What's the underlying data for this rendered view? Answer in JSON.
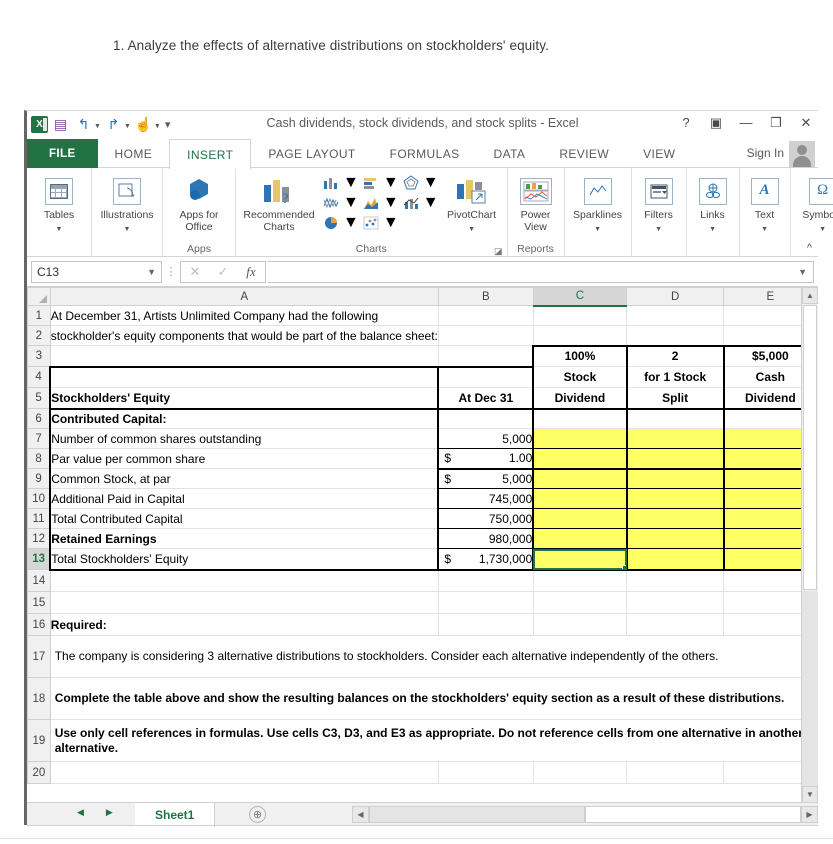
{
  "question": {
    "number": "1.",
    "text": "Analyze the effects of alternative distributions on stockholders' equity."
  },
  "window": {
    "title": "Cash dividends, stock dividends, and stock splits - Excel",
    "sign_in": "Sign In",
    "buttons": {
      "help": "?",
      "ribbon_display": "▣",
      "minimize": "—",
      "restore": "❐",
      "close": "✕"
    },
    "qat": {
      "save": "save-icon",
      "undo": "undo-icon",
      "redo": "redo-icon",
      "touch": "touch-mode-icon",
      "more": "customize-icon"
    }
  },
  "ribbon": {
    "tabs": [
      {
        "label": "FILE",
        "active": false
      },
      {
        "label": "HOME",
        "active": false
      },
      {
        "label": "INSERT",
        "active": true
      },
      {
        "label": "PAGE LAYOUT",
        "active": false
      },
      {
        "label": "FORMULAS",
        "active": false
      },
      {
        "label": "DATA",
        "active": false
      },
      {
        "label": "REVIEW",
        "active": false
      },
      {
        "label": "VIEW",
        "active": false
      }
    ],
    "groups": [
      {
        "label": "",
        "items": [
          {
            "label": "Tables",
            "dropdown": true
          }
        ]
      },
      {
        "label": "",
        "items": [
          {
            "label": "Illustrations",
            "dropdown": true
          }
        ]
      },
      {
        "label": "Apps",
        "items": [
          {
            "label": "Apps for Office",
            "dropdown": true
          }
        ]
      },
      {
        "label": "Charts",
        "items": [
          {
            "label": "Recommended Charts",
            "dropdown": false
          },
          {
            "label": "PivotChart",
            "dropdown": true
          }
        ]
      },
      {
        "label": "Reports",
        "items": [
          {
            "label": "Power View",
            "dropdown": false
          }
        ]
      },
      {
        "label": "",
        "items": [
          {
            "label": "Sparklines",
            "dropdown": true
          }
        ]
      },
      {
        "label": "",
        "items": [
          {
            "label": "Filters",
            "dropdown": true
          }
        ]
      },
      {
        "label": "",
        "items": [
          {
            "label": "Links",
            "dropdown": true
          }
        ]
      },
      {
        "label": "",
        "items": [
          {
            "label": "Text",
            "dropdown": true
          }
        ]
      },
      {
        "label": "",
        "items": [
          {
            "label": "Symbols",
            "dropdown": true
          }
        ]
      }
    ],
    "collapse": "^"
  },
  "formula_bar": {
    "name_box": "C13",
    "formula": "",
    "cancel": "✕",
    "enter": "✓",
    "fx": "fx"
  },
  "sheet": {
    "columns": [
      "A",
      "B",
      "C",
      "D",
      "E"
    ],
    "selected_column": "C",
    "selected_cell": "C13",
    "rows": [
      {
        "n": "1",
        "A": "At December 31,  Artists Unlimited Company had the following",
        "B": "",
        "C": "",
        "D": "",
        "E": ""
      },
      {
        "n": "2",
        "A": "stockholder's equity components that would be part of the balance sheet:",
        "B": "",
        "C": "",
        "D": "",
        "E": ""
      },
      {
        "n": "3",
        "A": "",
        "B": "",
        "C": "100%",
        "D": "2",
        "E": "$5,000"
      },
      {
        "n": "4",
        "A": "",
        "B": "",
        "C": "Stock",
        "D": "for 1 Stock",
        "E": "Cash"
      },
      {
        "n": "5",
        "A": "Stockholders' Equity",
        "B": "At Dec 31",
        "C": "Dividend",
        "D": "Split",
        "E": "Dividend"
      },
      {
        "n": "6",
        "A": "Contributed Capital:",
        "B": "",
        "C": "",
        "D": "",
        "E": ""
      },
      {
        "n": "7",
        "A": "Number of common shares outstanding",
        "B": "5,000",
        "C": "",
        "D": "",
        "E": ""
      },
      {
        "n": "8",
        "A": "Par value per common share",
        "B": "1.00",
        "B_dollar": "$",
        "C": "",
        "D": "",
        "E": ""
      },
      {
        "n": "9",
        "A": "   Common Stock, at par",
        "B": "5,000",
        "B_dollar": "$",
        "C": "",
        "D": "",
        "E": ""
      },
      {
        "n": "10",
        "A": "   Additional Paid in Capital",
        "B": "745,000",
        "C": "",
        "D": "",
        "E": ""
      },
      {
        "n": "11",
        "A": "      Total Contributed Capital",
        "B": "750,000",
        "C": "",
        "D": "",
        "E": ""
      },
      {
        "n": "12",
        "A": "Retained Earnings",
        "B": "980,000",
        "C": "",
        "D": "",
        "E": ""
      },
      {
        "n": "13",
        "A": "      Total Stockholders' Equity",
        "B": "1,730,000",
        "B_dollar": "$",
        "C": "",
        "D": "",
        "E": ""
      },
      {
        "n": "14",
        "A": "",
        "B": "",
        "C": "",
        "D": "",
        "E": ""
      },
      {
        "n": "15",
        "A": "",
        "B": "",
        "C": "",
        "D": "",
        "E": ""
      },
      {
        "n": "16",
        "A": "Required:",
        "B": "",
        "C": "",
        "D": "",
        "E": ""
      },
      {
        "n": "17",
        "A": "The company is considering 3 alternative distributions to stockholders.  Consider each alternative independently of the others.",
        "B": "",
        "C": "",
        "D": "",
        "E": ""
      },
      {
        "n": "18",
        "A": "Complete the table above and show the resulting balances on the stockholders' equity section as a result of these distributions.",
        "B": "",
        "C": "",
        "D": "",
        "E": ""
      },
      {
        "n": "19",
        "A": "Use only cell references in formulas.  Use cells C3, D3, and E3 as appropriate.  Do not reference cells from one alternative in another alternative.",
        "B": "",
        "C": "",
        "D": "",
        "E": ""
      },
      {
        "n": "20",
        "A": "",
        "B": "",
        "C": "",
        "D": "",
        "E": ""
      }
    ],
    "highlight_color": "#ffff66",
    "selection_color": "#217346"
  },
  "sheet_tabs": {
    "tabs": [
      "Sheet1"
    ],
    "active": "Sheet1",
    "add_label": "⊕",
    "prev": "◀",
    "next": "▶"
  }
}
